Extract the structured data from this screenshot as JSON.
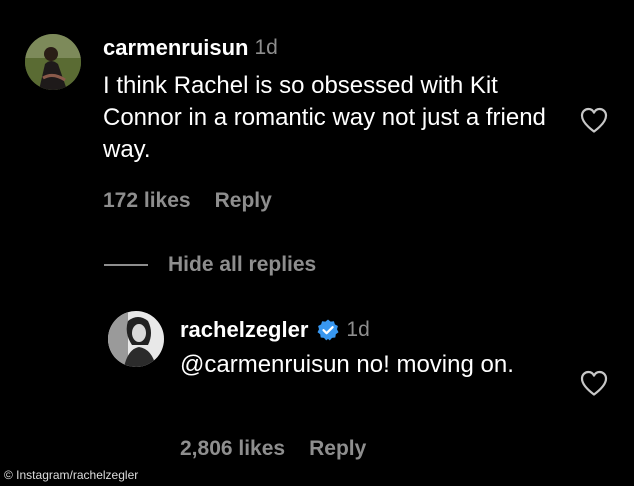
{
  "comments": [
    {
      "username": "carmenruisun",
      "time": "1d",
      "text": "I think Rachel is so obsessed with Kit Connor in a romantic way not just a friend way.",
      "likes": "172 likes",
      "reply": "Reply"
    }
  ],
  "replies_toggle": "Hide all replies",
  "reply_comment": {
    "username": "rachelzegler",
    "verified": true,
    "time": "1d",
    "text": "@carmenruisun no! moving on.",
    "likes": "2,806 likes",
    "reply": "Reply"
  },
  "credit": "© Instagram/rachelzegler",
  "icons": {
    "like": "heart-outline-icon",
    "verified": "verified-badge-icon"
  },
  "colors": {
    "background": "#000000",
    "text": "#ffffff",
    "muted": "#8e8e8e",
    "verified": "#3897f0"
  }
}
